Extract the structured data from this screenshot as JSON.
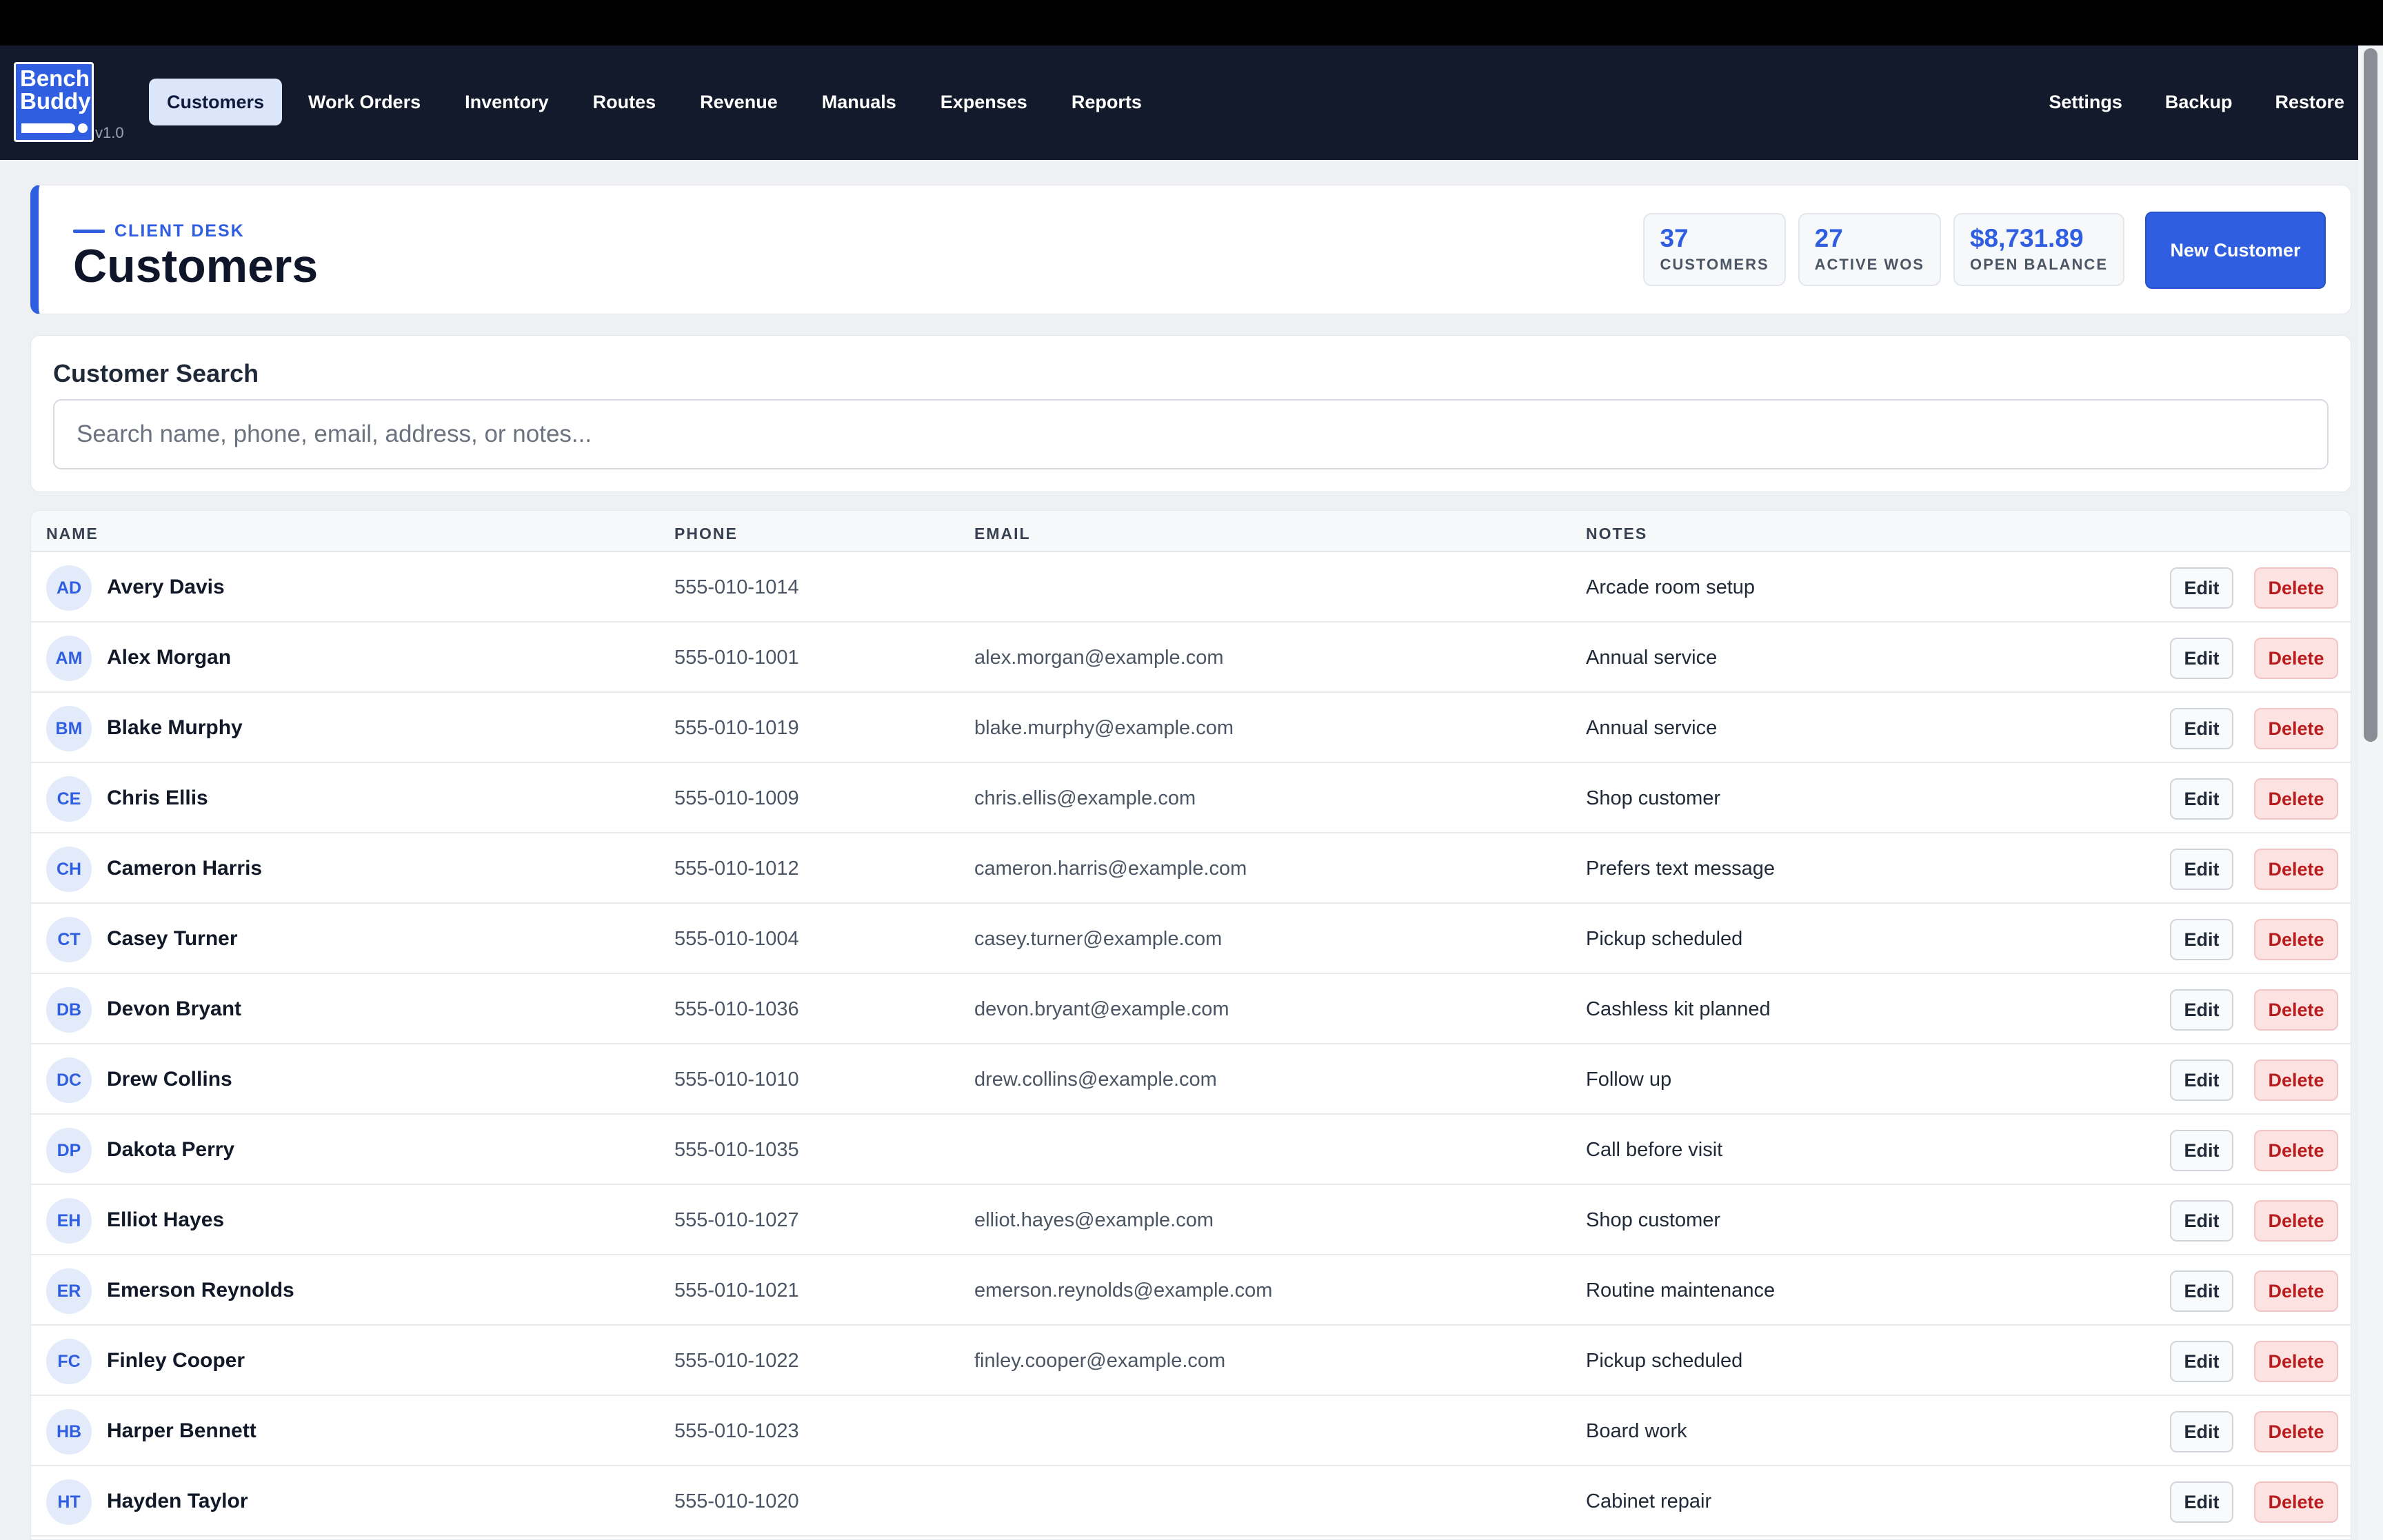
{
  "app": {
    "logo_text": "Bench Buddy",
    "version": "v1.0"
  },
  "nav": {
    "tabs": [
      {
        "label": "Customers",
        "active": true
      },
      {
        "label": "Work Orders"
      },
      {
        "label": "Inventory"
      },
      {
        "label": "Routes"
      },
      {
        "label": "Revenue"
      },
      {
        "label": "Manuals"
      },
      {
        "label": "Expenses"
      },
      {
        "label": "Reports"
      }
    ],
    "right": [
      {
        "label": "Settings"
      },
      {
        "label": "Backup"
      },
      {
        "label": "Restore"
      }
    ]
  },
  "header": {
    "eyebrow": "CLIENT DESK",
    "title": "Customers",
    "stats": [
      {
        "value": "37",
        "label": "CUSTOMERS"
      },
      {
        "value": "27",
        "label": "ACTIVE WOS"
      },
      {
        "value": "$8,731.89",
        "label": "OPEN BALANCE"
      }
    ],
    "new_button": "New Customer"
  },
  "search": {
    "title": "Customer Search",
    "value": "",
    "placeholder": "Search name, phone, email, address, or notes..."
  },
  "table": {
    "columns": [
      "NAME",
      "PHONE",
      "EMAIL",
      "NOTES"
    ],
    "edit_label": "Edit",
    "delete_label": "Delete",
    "rows": [
      {
        "initials": "AD",
        "name": "Avery Davis",
        "phone": "555-010-1014",
        "email": "",
        "notes": "Arcade room setup"
      },
      {
        "initials": "AM",
        "name": "Alex Morgan",
        "phone": "555-010-1001",
        "email": "alex.morgan@example.com",
        "notes": "Annual service"
      },
      {
        "initials": "BM",
        "name": "Blake Murphy",
        "phone": "555-010-1019",
        "email": "blake.murphy@example.com",
        "notes": "Annual service"
      },
      {
        "initials": "CE",
        "name": "Chris Ellis",
        "phone": "555-010-1009",
        "email": "chris.ellis@example.com",
        "notes": "Shop customer"
      },
      {
        "initials": "CH",
        "name": "Cameron Harris",
        "phone": "555-010-1012",
        "email": "cameron.harris@example.com",
        "notes": "Prefers text message"
      },
      {
        "initials": "CT",
        "name": "Casey Turner",
        "phone": "555-010-1004",
        "email": "casey.turner@example.com",
        "notes": "Pickup scheduled"
      },
      {
        "initials": "DB",
        "name": "Devon Bryant",
        "phone": "555-010-1036",
        "email": "devon.bryant@example.com",
        "notes": "Cashless kit planned"
      },
      {
        "initials": "DC",
        "name": "Drew Collins",
        "phone": "555-010-1010",
        "email": "drew.collins@example.com",
        "notes": "Follow up"
      },
      {
        "initials": "DP",
        "name": "Dakota Perry",
        "phone": "555-010-1035",
        "email": "",
        "notes": "Call before visit"
      },
      {
        "initials": "EH",
        "name": "Elliot Hayes",
        "phone": "555-010-1027",
        "email": "elliot.hayes@example.com",
        "notes": "Shop customer"
      },
      {
        "initials": "ER",
        "name": "Emerson Reynolds",
        "phone": "555-010-1021",
        "email": "emerson.reynolds@example.com",
        "notes": "Routine maintenance"
      },
      {
        "initials": "FC",
        "name": "Finley Cooper",
        "phone": "555-010-1022",
        "email": "finley.cooper@example.com",
        "notes": "Pickup scheduled"
      },
      {
        "initials": "HB",
        "name": "Harper Bennett",
        "phone": "555-010-1023",
        "email": "",
        "notes": "Board work"
      },
      {
        "initials": "HT",
        "name": "Hayden Taylor",
        "phone": "555-010-1020",
        "email": "",
        "notes": "Cabinet repair"
      }
    ]
  }
}
